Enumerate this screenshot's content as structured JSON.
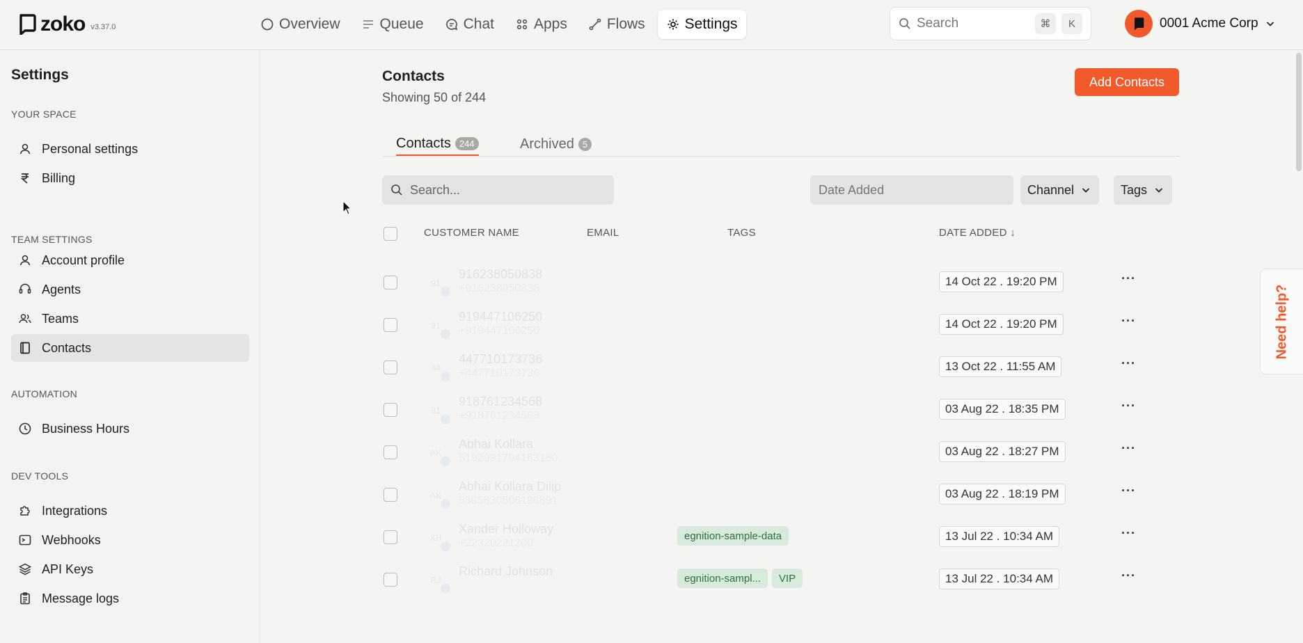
{
  "app": {
    "name": "zoko",
    "version": "v3.37.0"
  },
  "nav": [
    {
      "label": "Overview",
      "icon": "circle-icon"
    },
    {
      "label": "Queue",
      "icon": "queue-icon"
    },
    {
      "label": "Chat",
      "icon": "chat-icon"
    },
    {
      "label": "Apps",
      "icon": "apps-icon"
    },
    {
      "label": "Flows",
      "icon": "flows-icon"
    },
    {
      "label": "Settings",
      "icon": "gear-icon",
      "active": true
    }
  ],
  "top_search": {
    "placeholder": "Search",
    "kbd1": "⌘",
    "kbd2": "K"
  },
  "account": {
    "name": "0001 Acme Corp"
  },
  "sidebar": {
    "title": "Settings",
    "sections": [
      {
        "label": "YOUR SPACE",
        "items": [
          {
            "label": "Personal settings"
          },
          {
            "label": "Billing"
          }
        ]
      },
      {
        "label": "TEAM SETTINGS",
        "items": [
          {
            "label": "Account profile"
          },
          {
            "label": "Agents"
          },
          {
            "label": "Teams"
          },
          {
            "label": "Contacts",
            "active": true
          }
        ]
      },
      {
        "label": "AUTOMATION",
        "items": [
          {
            "label": "Business Hours"
          }
        ]
      },
      {
        "label": "DEV TOOLS",
        "items": [
          {
            "label": "Integrations"
          },
          {
            "label": "Webhooks"
          },
          {
            "label": "API Keys"
          },
          {
            "label": "Message logs"
          }
        ]
      }
    ]
  },
  "page": {
    "title": "Contacts",
    "subtitle": "Showing 50 of 244",
    "add_button": "Add Contacts",
    "tabs": [
      {
        "label": "Contacts",
        "count": "244",
        "active": true
      },
      {
        "label": "Archived",
        "count": "5"
      }
    ],
    "search_placeholder": "Search...",
    "date_filter": "Date Added",
    "channel_filter": "Channel",
    "tags_filter": "Tags",
    "columns": {
      "name": "CUSTOMER NAME",
      "email": "EMAIL",
      "tags": "TAGS",
      "date": "DATE ADDED ↓"
    },
    "more": "···"
  },
  "rows": [
    {
      "initials": "91",
      "name": "916238050838",
      "phone": "+916238050838",
      "date": "14 Oct 22 . 19:20 PM",
      "tags": []
    },
    {
      "initials": "91",
      "name": "919447106250",
      "phone": "+919447106250",
      "date": "14 Oct 22 . 19:20 PM",
      "tags": []
    },
    {
      "initials": "44",
      "name": "447710173736",
      "phone": "+447710173736",
      "date": "13 Oct 22 . 11:55 AM",
      "tags": []
    },
    {
      "initials": "91",
      "name": "918761234568",
      "phone": "+918761234568",
      "date": "03 Aug 22 . 18:35 PM",
      "tags": []
    },
    {
      "initials": "AK",
      "name": "Abhai Kollara",
      "phone": "519299179416315​0",
      "date": "03 Aug 22 . 18:27 PM",
      "tags": []
    },
    {
      "initials": "AK",
      "name": "Abhai Kollara Dilip",
      "phone": "5505830506196891",
      "date": "03 Aug 22 . 18:19 PM",
      "tags": []
    },
    {
      "initials": "XH",
      "name": "Xander Holloway",
      "phone": "+22320221200",
      "date": "13 Jul 22 . 10:34 AM",
      "tags": [
        "egnition-sample-data"
      ]
    },
    {
      "initials": "RJ",
      "name": "Richard Johnson",
      "phone": "",
      "date": "13 Jul 22 . 10:34 AM",
      "tags": [
        "egnition-sampl...",
        "VIP"
      ]
    }
  ],
  "help": {
    "label": "Need help?"
  },
  "colors": {
    "accent": "#f25a2b",
    "tag_bg": "#d7eadc",
    "tag_text": "#2f6f45"
  }
}
